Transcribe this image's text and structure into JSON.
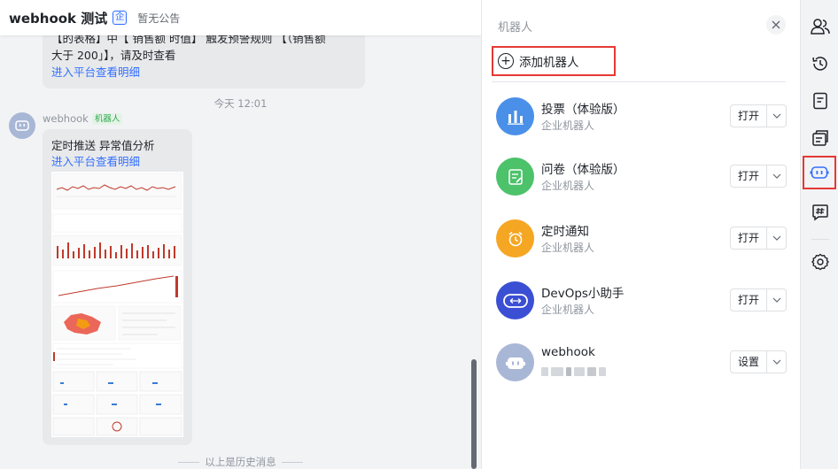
{
  "chat": {
    "title": "webhook 测试",
    "enterprise_badge": "企",
    "notice": "暂无公告",
    "top_message_line1": "【的表格】中【 销售额 时值】 触发预警规则 【（销售额",
    "top_message_line2": "大于 200」】，请及时查看",
    "top_message_link": "进入平台查看明细",
    "timestamp": "今天 12:01",
    "sender_name": "webhook",
    "sender_tag": "机器人",
    "message_title": "定时推送 异常值分析",
    "message_link": "进入平台查看明细",
    "history_label": "以上是历史消息"
  },
  "panel": {
    "title": "机器人",
    "close_icon": "close-icon",
    "add_robot_label": "添加机器人",
    "robots": [
      {
        "name": "投票（体验版）",
        "subtitle": "企业机器人",
        "action": "打开",
        "icon": "bar-chart-icon",
        "color": "#4a90e8"
      },
      {
        "name": "问卷（体验版）",
        "subtitle": "企业机器人",
        "action": "打开",
        "icon": "survey-icon",
        "color": "#4cc26a"
      },
      {
        "name": "定时通知",
        "subtitle": "企业机器人",
        "action": "打开",
        "icon": "alarm-clock-icon",
        "color": "#f5a623"
      },
      {
        "name": "DevOps小助手",
        "subtitle": "企业机器人",
        "action": "打开",
        "icon": "devops-icon",
        "color": "#3a4fd4"
      },
      {
        "name": "webhook",
        "subtitle": "",
        "action": "设置",
        "icon": "bot-icon",
        "color": "#a9b7d6"
      }
    ]
  },
  "rail": {
    "items": [
      "members-icon",
      "history-icon",
      "notes-icon",
      "announcement-icon",
      "robot-icon",
      "hashtag-icon",
      "settings-icon"
    ],
    "active": "robot-icon"
  }
}
